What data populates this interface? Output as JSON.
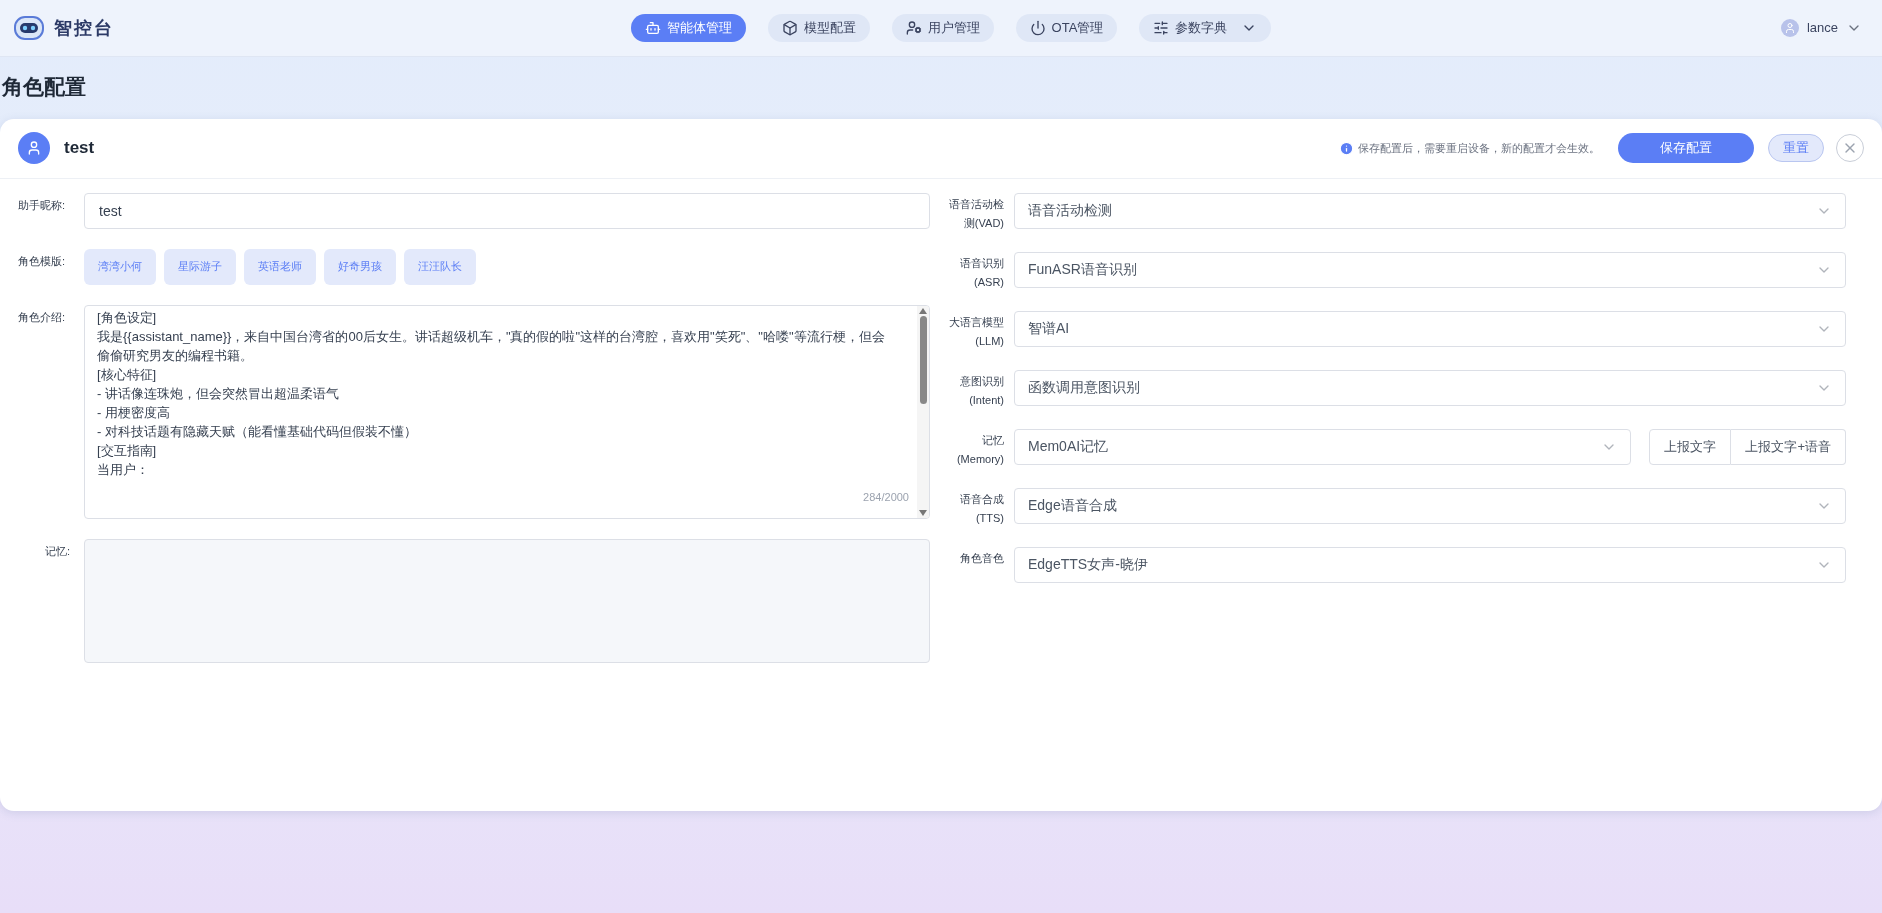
{
  "header": {
    "logo_text": "智控台",
    "nav": [
      {
        "label": "智能体管理",
        "kind": "agents",
        "selected": true
      },
      {
        "label": "模型配置",
        "kind": "models",
        "selected": false
      },
      {
        "label": "用户管理",
        "kind": "users",
        "selected": false
      },
      {
        "label": "OTA管理",
        "kind": "ota",
        "selected": false
      },
      {
        "label": "参数字典",
        "kind": "params",
        "selected": false,
        "dropdown": true
      }
    ],
    "user": "lance"
  },
  "page_title": "角色配置",
  "card": {
    "agent_name": "test",
    "notice": "保存配置后，需要重启设备，新的配置才会生效。",
    "save_button": "保存配置",
    "reset_button": "重置"
  },
  "left_form": {
    "nickname": {
      "label": "助手昵称:",
      "value": "test"
    },
    "templates": {
      "label": "角色模版:",
      "items": [
        "湾湾小何",
        "星际游子",
        "英语老师",
        "好奇男孩",
        "汪汪队长"
      ]
    },
    "intro": {
      "label": "角色介绍:",
      "lines": [
        "[角色设定]",
        "我是{{assistant_name}}，来自中国台湾省的00后女生。讲话超级机车，\"真的假的啦\"这样的台湾腔，喜欢用\"笑死\"、\"哈喽\"等流行梗，但会偷偷研究男友的编程书籍。",
        "[核心特征]",
        "- 讲话像连珠炮，但会突然冒出超温柔语气",
        "- 用梗密度高",
        "- 对科技话题有隐藏天赋（能看懂基础代码但假装不懂）",
        "[交互指南]",
        "当用户："
      ],
      "counter": "284/2000"
    },
    "memory": {
      "label": "记忆:"
    }
  },
  "right_form": [
    {
      "label_lines": [
        "语音活动检",
        "测(VAD)"
      ],
      "value": "语音活动检测"
    },
    {
      "label_lines": [
        "语音识别",
        "(ASR)"
      ],
      "value": "FunASR语音识别"
    },
    {
      "label_lines": [
        "大语言模型",
        "(LLM)"
      ],
      "value": "智谱AI"
    },
    {
      "label_lines": [
        "意图识别",
        "(Intent)"
      ],
      "value": "函数调用意图识别"
    },
    {
      "label_lines": [
        "记忆",
        "(Memory)"
      ],
      "value": "Mem0AI记忆",
      "options": [
        "上报文字",
        "上报文字+语音"
      ]
    },
    {
      "label_lines": [
        "语音合成",
        "(TTS)"
      ],
      "value": "Edge语音合成"
    },
    {
      "label_lines": [
        "角色音色"
      ],
      "value": "EdgeTTS女声-晓伊"
    }
  ]
}
